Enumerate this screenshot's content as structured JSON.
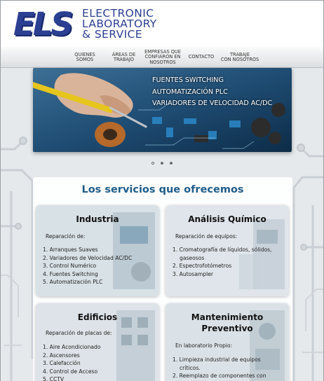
{
  "header": {
    "logo_mark": "ELS",
    "logo_lines": [
      "ELECTRONIC",
      "LABORATORY",
      "& SERVICE"
    ]
  },
  "nav": {
    "items": [
      {
        "label": "QUIENES\nSOMOS"
      },
      {
        "label": "ÁREAS DE\nTRABAJO"
      },
      {
        "label": "EMPRESAS QUE\nCONFIARON EN\nNOSOTROS"
      },
      {
        "label": "CONTACTO"
      },
      {
        "label": "TRABAJE\nCON NOSOTROS"
      }
    ]
  },
  "banner": {
    "lines": [
      "FUENTES SWITCHING",
      "AUTOMATIZACIÓN PLC",
      "VARIADORES DE VELOCIDAD AC/DC"
    ],
    "slides": 3,
    "active_slide": 1
  },
  "services": {
    "title": "Los servicios que ofrecemos",
    "cards": [
      {
        "title": "Industria",
        "subtitle": "Reparación de:",
        "items": [
          "1. Arranques Suaves",
          "2. Variadores de Velocidad AC/DC",
          "3. Control Numérico",
          "4. Fuentes Switching",
          "5. Automatización PLC"
        ]
      },
      {
        "title": "Análisis Químico",
        "subtitle": "Reparación de equipos:",
        "items": [
          "1. Cromatografía de líquidos, sólidos,",
          "gaseosos",
          "2. Espectrofotómetros",
          "3. Autosampler"
        ]
      },
      {
        "title": "Edificios",
        "subtitle": "Reparación de placas de:",
        "items": [
          "1. Aire Acondicionado",
          "2. Ascensores",
          "3. Calefacción",
          "4. Control de Acceso",
          "5. CCTV"
        ]
      },
      {
        "title": "Mantenimiento Preventivo",
        "subtitle": "En laboratorio Propio:",
        "items": [
          "1. Limpieza industrial de equipos",
          "críticos.",
          "2. Reemplazo de componentes con"
        ]
      }
    ]
  },
  "colors": {
    "brand_blue": "#2b3f93",
    "title_blue": "#1e5d8a",
    "background": "#e9ecee"
  }
}
